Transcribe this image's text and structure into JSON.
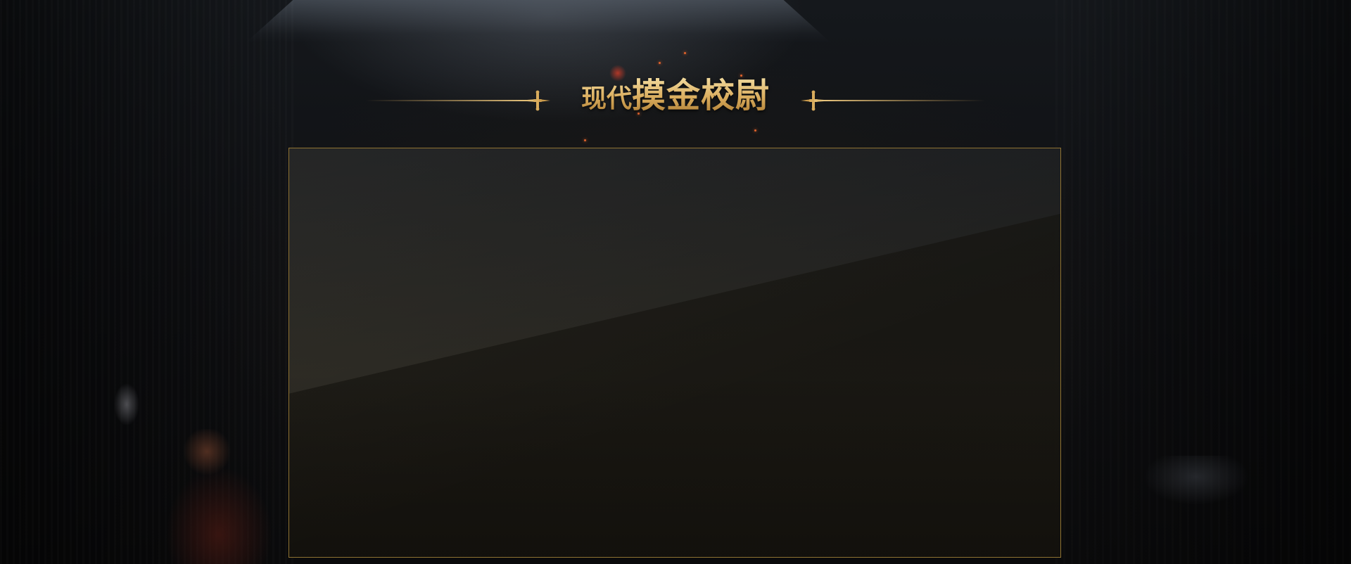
{
  "page": {
    "title_small": "现代",
    "title_big": "摸金校尉"
  },
  "panel": {
    "content": ""
  },
  "colors": {
    "gold": "#d9ac5d",
    "gold_light": "#f6e2a8",
    "border": "#8f7333",
    "background": "#0b0c0e"
  },
  "icons": {
    "left_ornament": "sword-ornament-icon",
    "right_ornament": "sword-ornament-icon"
  }
}
